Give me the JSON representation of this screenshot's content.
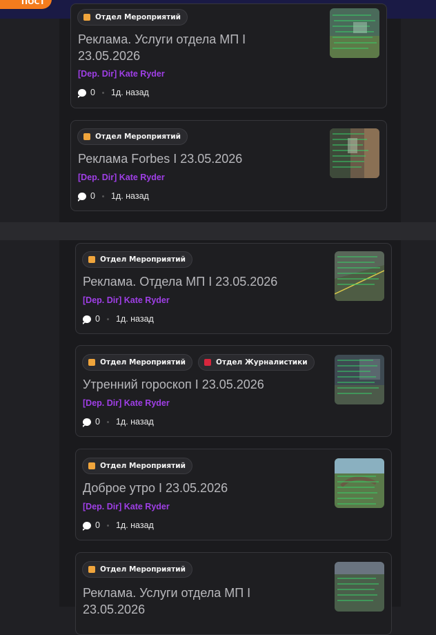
{
  "header": {
    "badge_text": "ПОСТ"
  },
  "colors": {
    "accent_orange": "#f47c1d",
    "author_purple": "#9f3fe6",
    "tag_events": "#f0a53c",
    "tag_journalism": "#d7263d"
  },
  "tags": {
    "events": "Отдел Мероприятий",
    "journalism": "Отдел Журналистики"
  },
  "posts": [
    {
      "title_line1": "Реклама. Услуги отдела МП I",
      "title_line2": "23.05.2026",
      "author": "[Dep. Dir] Kate Ryder",
      "comments": "0",
      "time": "1д. назад"
    },
    {
      "title": "Реклама Forbes I 23.05.2026",
      "author": "[Dep. Dir] Kate Ryder",
      "comments": "0",
      "time": "1д. назад"
    },
    {
      "title": "Реклама. Отдела МП I 23.05.2026",
      "author": "[Dep. Dir] Kate Ryder",
      "comments": "0",
      "time": "1д. назад"
    },
    {
      "title": "Утренний гороскоп I 23.05.2026",
      "author": "[Dep. Dir] Kate Ryder",
      "comments": "0",
      "time": "1д. назад"
    },
    {
      "title": "Доброе утро I 23.05.2026",
      "author": "[Dep. Dir] Kate Ryder",
      "comments": "0",
      "time": "1д. назад"
    },
    {
      "title_line1": "Реклама. Услуги отдела МП I",
      "title_line2": "23.05.2026"
    }
  ]
}
